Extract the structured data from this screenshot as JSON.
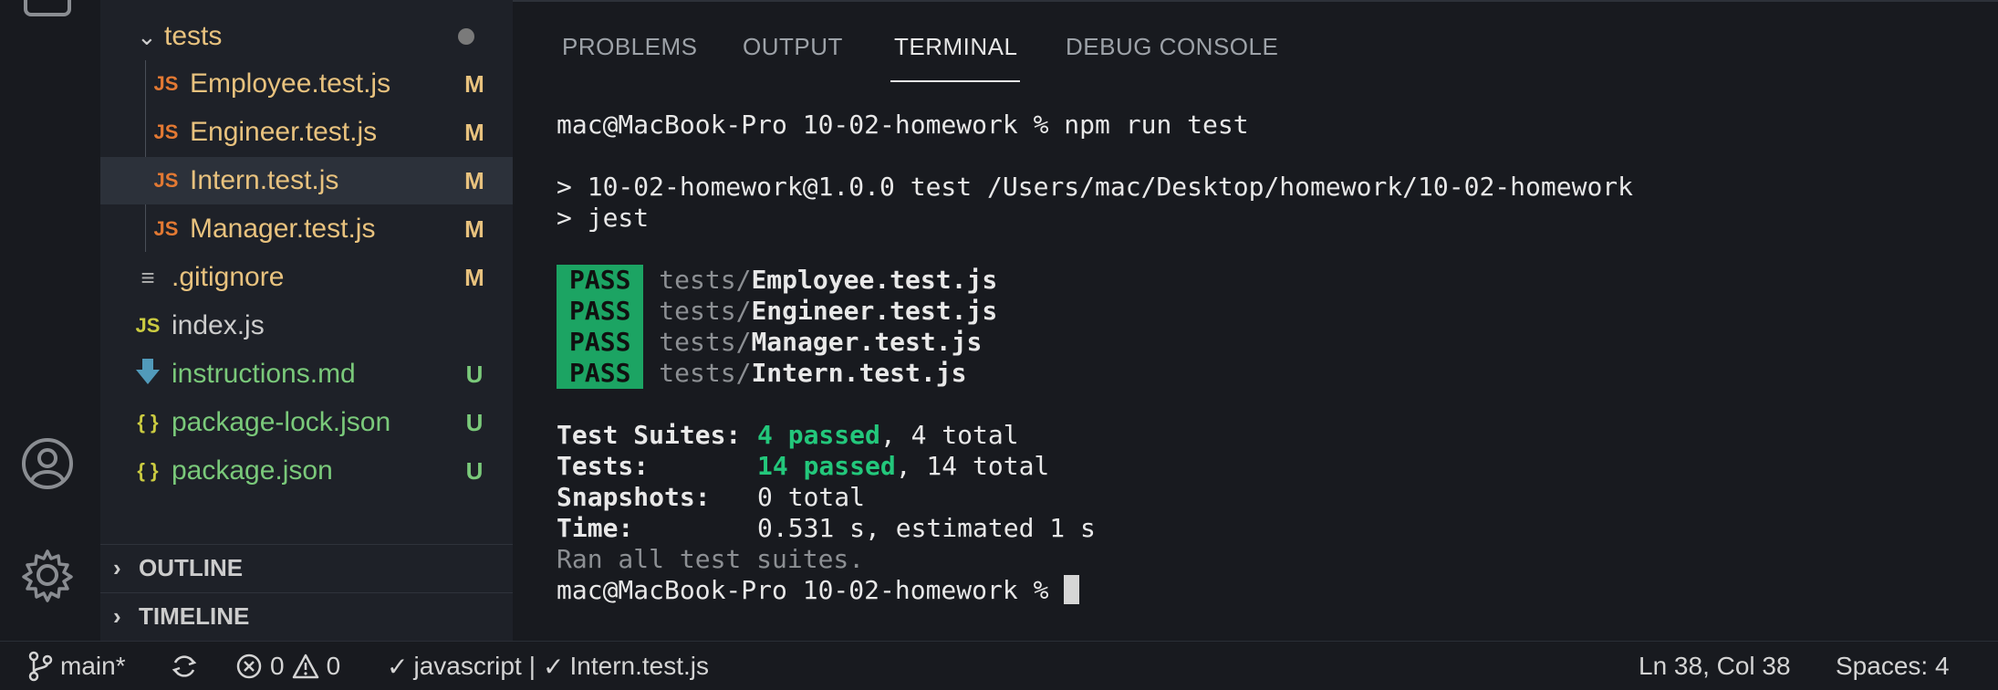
{
  "sidebar": {
    "tree": [
      {
        "name": "tests",
        "type": "folder",
        "color": "#e8c27e",
        "indicator": "dot"
      },
      {
        "name": "Employee.test.js",
        "icon": "JS",
        "status": "M",
        "color": "#e8c27e"
      },
      {
        "name": "Engineer.test.js",
        "icon": "JS",
        "status": "M",
        "color": "#e8c27e"
      },
      {
        "name": "Intern.test.js",
        "icon": "JS",
        "status": "M",
        "color": "#e8c27e",
        "selected": true
      },
      {
        "name": "Manager.test.js",
        "icon": "JS",
        "status": "M",
        "color": "#e8c27e"
      },
      {
        "name": ".gitignore",
        "icon": "lines-icon",
        "status": "M",
        "color": "#e8c27e"
      },
      {
        "name": "index.js",
        "icon": "JS",
        "status": "",
        "color": "#cccccc"
      },
      {
        "name": "instructions.md",
        "icon": "download-arrow-icon",
        "status": "U",
        "color": "#7ac97a"
      },
      {
        "name": "package-lock.json",
        "icon": "{ }",
        "status": "U",
        "color": "#7ac97a"
      },
      {
        "name": "package.json",
        "icon": "{ }",
        "status": "U",
        "color": "#7ac97a"
      }
    ],
    "outline_label": "OUTLINE",
    "timeline_label": "TIMELINE"
  },
  "panel": {
    "tabs": [
      "PROBLEMS",
      "OUTPUT",
      "TERMINAL",
      "DEBUG CONSOLE"
    ],
    "active_tab": "TERMINAL"
  },
  "terminal": {
    "prompt": "mac@MacBook-Pro 10-02-homework % ",
    "command": "npm run test",
    "script_line": "> 10-02-homework@1.0.0 test /Users/mac/Desktop/homework/10-02-homework",
    "jest_line": "> jest",
    "badge": "PASS",
    "dir_prefix": "tests/",
    "passes": [
      "Employee.test.js",
      "Engineer.test.js",
      "Manager.test.js",
      "Intern.test.js"
    ],
    "suites_label": "Test Suites:",
    "suites_passed": "4 passed",
    "suites_total": ", 4 total",
    "tests_label": "Tests:",
    "tests_passed": "14 passed",
    "tests_total": ", 14 total",
    "snapshots_label": "Snapshots:",
    "snapshots_value": "0 total",
    "time_label": "Time:",
    "time_value": "0.531 s, estimated 1 s",
    "ran_line": "Ran all test suites.",
    "final_prompt": "mac@MacBook-Pro 10-02-homework % "
  },
  "status_bar": {
    "branch": "main*",
    "errors": "0",
    "warnings": "0",
    "language_check": "javascript",
    "separator": "|",
    "file_check": "Intern.test.js",
    "position": "Ln 38, Col 38",
    "spaces": "Spaces: 4"
  },
  "colors": {
    "modified": "#e8c27e",
    "untracked": "#7ac97a",
    "js_icon": "#e37933",
    "pass_badge": "#1ca463",
    "passed_text": "#23c77b"
  }
}
